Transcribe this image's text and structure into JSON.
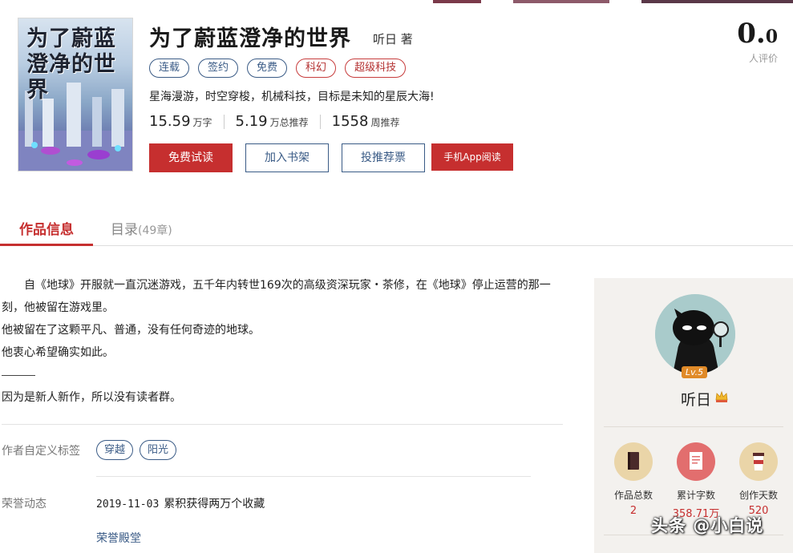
{
  "book": {
    "cover_text": "为了蔚蓝澄净的世界",
    "title": "为了蔚蓝澄净的世界",
    "author": "听日 著",
    "tags": [
      "连载",
      "签约",
      "免费",
      "科幻",
      "超级科技"
    ],
    "intro": "星海漫游，时空穿梭，机械科技，目标是未知的星辰大海!",
    "stats": [
      {
        "value": "15.59",
        "unit": "万字"
      },
      {
        "value": "5.19",
        "unit": "万总推荐"
      },
      {
        "value": "1558",
        "unit": "周推荐"
      }
    ],
    "buttons": {
      "read_free": "免费试读",
      "add_shelf": "加入书架",
      "vote": "投推荐票",
      "app_read": "手机App阅读"
    },
    "rating": {
      "score_int": "0.",
      "score_dec": "0",
      "label": "人评价"
    }
  },
  "tabs": {
    "info": "作品信息",
    "catalog": "目录",
    "catalog_count": "(49章)"
  },
  "description": {
    "p1": "自《地球》开服就一直沉迷游戏，五千年内转世169次的高级资深玩家・茶修，在《地球》停止运营的那一刻，他被留在游戏里。",
    "p2": "他被留在了这颗平凡、普通，没有任何奇迹的地球。",
    "p3": "他衷心希望确实如此。",
    "p4": "因为是新人新作，所以没有读者群。"
  },
  "custom_tags": {
    "label": "作者自定义标签",
    "items": [
      "穿越",
      "阳光"
    ]
  },
  "honors": {
    "label": "荣誉动态",
    "date": "2019-11-03",
    "text": "累积获得两万个收藏",
    "link": "荣誉殿堂"
  },
  "author_panel": {
    "level": "Lv.5",
    "name": "听日",
    "stats": [
      {
        "label": "作品总数",
        "value": "2",
        "color": "#e8cf9e"
      },
      {
        "label": "累计字数",
        "value": "358.71万",
        "color": "#e06b6b"
      },
      {
        "label": "创作天数",
        "value": "520",
        "color": "#e8cf9e"
      }
    ]
  },
  "watermark": "头条 @小白说"
}
